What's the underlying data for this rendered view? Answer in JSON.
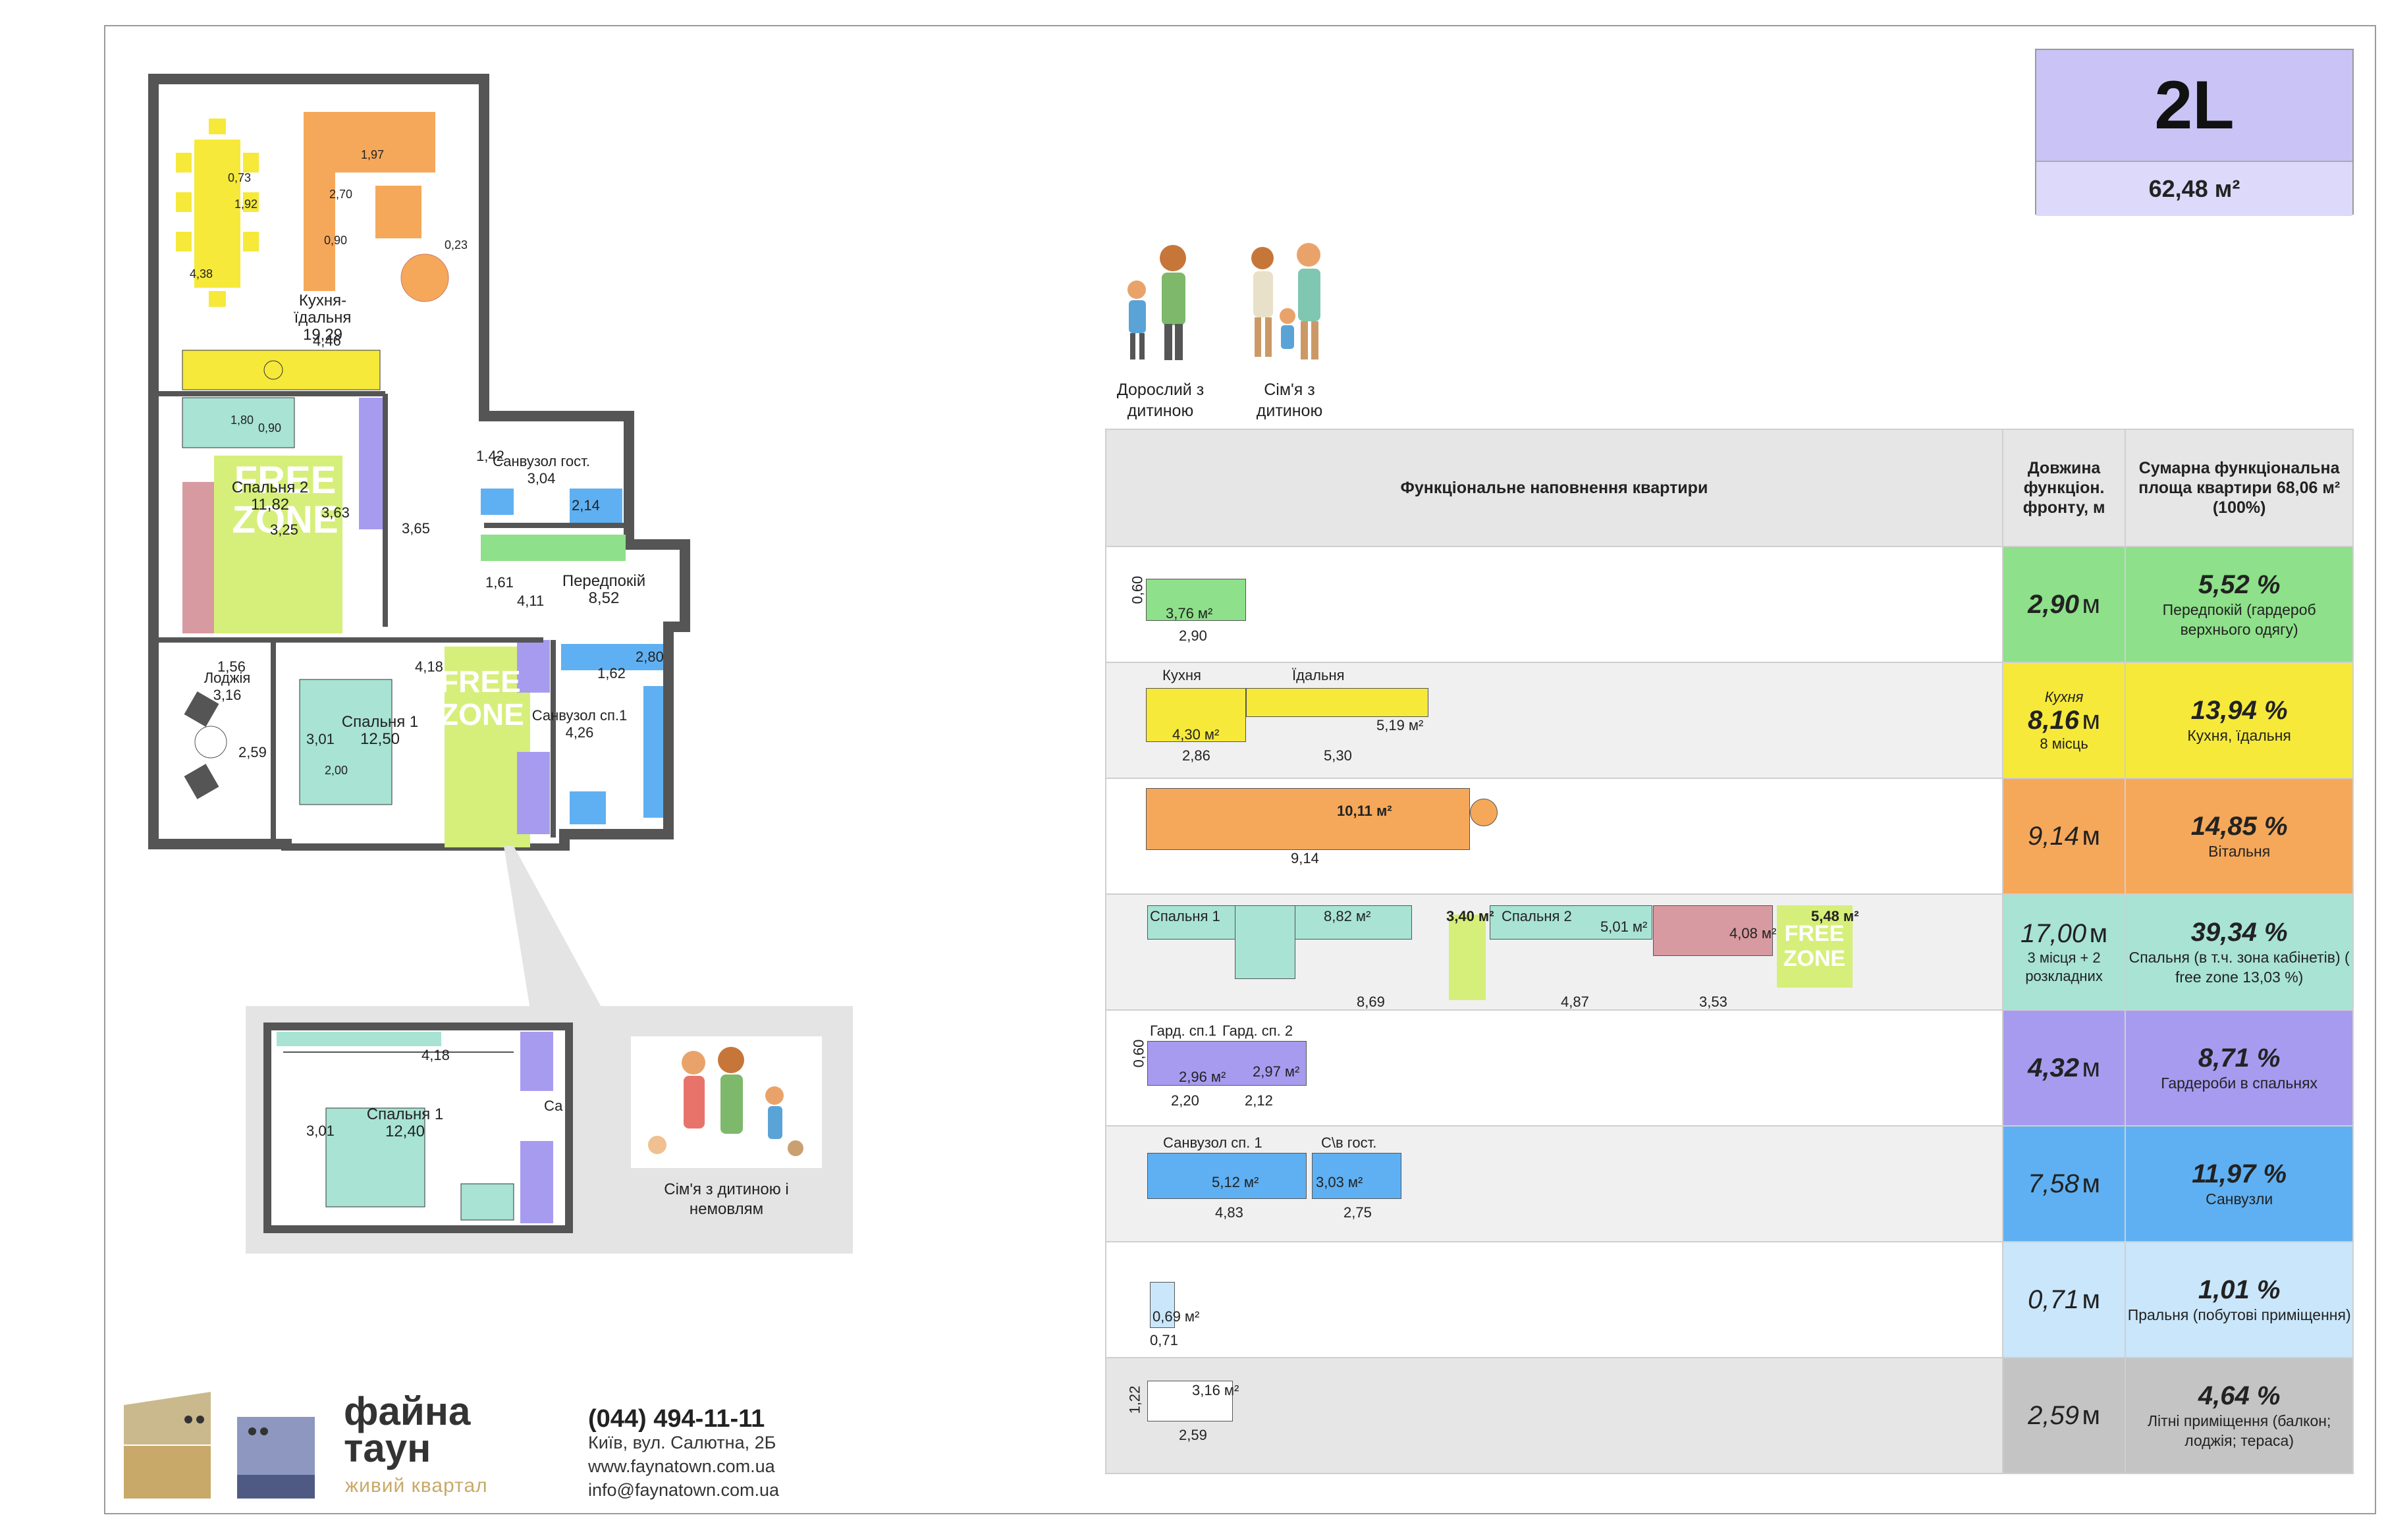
{
  "unit": {
    "code": "2L",
    "area": "62,48 м²"
  },
  "icons": [
    {
      "name": "adult-with-child-icon",
      "label": "Дорослий з дитиною"
    },
    {
      "name": "family-with-child-icon",
      "label": "Сім'я з дитиною"
    }
  ],
  "infant_icon": {
    "label": "Сім'я з дитиною і немовлям"
  },
  "plan": {
    "kitchen": {
      "label": "Кухня-їдальня",
      "area": "19,29"
    },
    "bedroom2": {
      "label": "Спальня 2",
      "area": "11,82"
    },
    "bathroom_guest": {
      "label": "Санвузол гост.",
      "area": "3,04"
    },
    "hallway": {
      "label": "Передпокій",
      "area": "8,52"
    },
    "loggia": {
      "label": "Лоджія",
      "area": "3,16"
    },
    "bedroom1": {
      "label": "Спальня 1",
      "area": "12,50"
    },
    "bathroom1": {
      "label": "Санвузол сп.1",
      "area": "4,26"
    },
    "free_zone": "FREE ZONE",
    "dims": [
      "4,38",
      "4,46",
      "1,97",
      "2,70",
      "0,90",
      "0,73",
      "1,92",
      "0,23",
      "1,80",
      "0,90",
      "3,25",
      "3,63",
      "3,65",
      "1,42",
      "2,14",
      "1,61",
      "4,11",
      "1,56",
      "2,59",
      "4,18",
      "3,01",
      "2,00",
      "1,62",
      "2,80"
    ]
  },
  "inset": {
    "label": "Спальня 1",
    "area": "12,40",
    "dims": [
      "4,18",
      "3,01"
    ],
    "cut_label": "Са"
  },
  "table": {
    "header": {
      "col1": "Функціональне наповнення квартири",
      "col2": "Довжина функціон. фронту, м",
      "col3": "Сумарна функціональна площа квартири 68,06 м² (100%)"
    },
    "rows": [
      {
        "len": "2,90",
        "unit": "м",
        "len_bold": true,
        "len_top": "",
        "len_sub": "",
        "pct": "5,52 %",
        "desc": "Передпокій (гардероб верхнього одягу)",
        "len_color": "#8ee08a",
        "pct_color": "#8ee08a",
        "labels": [
          "0,60",
          "3,76 м²",
          "2,90"
        ]
      },
      {
        "len": "8,16",
        "unit": "м",
        "len_bold": true,
        "len_top": "Кухня",
        "len_sub": "8 місць",
        "pct": "13,94 %",
        "desc": "Кухня, їдальня",
        "len_color": "#f6e93a",
        "pct_color": "#f6e93a",
        "labels": [
          "Кухня",
          "Їдальня",
          "4,30 м²",
          "5,19 м²",
          "2,86",
          "5,30"
        ]
      },
      {
        "len": "9,14",
        "unit": "м",
        "len_bold": false,
        "len_top": "",
        "len_sub": "",
        "pct": "14,85 %",
        "desc": "Вітальня",
        "len_color": "#f5a85a",
        "pct_color": "#f5a85a",
        "labels": [
          "10,11 м²",
          "9,14"
        ]
      },
      {
        "len": "17,00",
        "unit": "м",
        "len_bold": false,
        "len_top": "",
        "len_sub": "3 місця + 2 розкладних",
        "pct": "39,34 %",
        "desc": "Спальня (в т.ч. зона кабінетів) ( free zone 13,03 %)",
        "len_color": "#a8e3d4",
        "pct_color": "#a8e3d4",
        "labels": [
          "Спальня 1",
          "8,82 м²",
          "3,40 м²",
          "Спальня 2",
          "5,01 м²",
          "4,08 м²",
          "5,48 м²",
          "8,69",
          "4,87",
          "3,53",
          "FREE ZONE"
        ]
      },
      {
        "len": "4,32",
        "unit": "м",
        "len_bold": true,
        "len_top": "",
        "len_sub": "",
        "pct": "8,71 %",
        "desc": "Гардероби в спальнях",
        "len_color": "#a79bf0",
        "pct_color": "#a79bf0",
        "labels": [
          "0,60",
          "Гард. сп.1",
          "Гард. сп. 2",
          "2,96 м²",
          "2,97 м²",
          "2,20",
          "2,12"
        ]
      },
      {
        "len": "7,58",
        "unit": "м",
        "len_bold": false,
        "len_top": "",
        "len_sub": "",
        "pct": "11,97 %",
        "desc": "Санвузли",
        "len_color": "#5fb0f2",
        "pct_color": "#5fb0f2",
        "labels": [
          "Санвузол сп. 1",
          "С\\в гост.",
          "5,12 м²",
          "3,03 м²",
          "4,83",
          "2,75"
        ]
      },
      {
        "len": "0,71",
        "unit": "м",
        "len_bold": false,
        "len_top": "",
        "len_sub": "",
        "pct": "1,01 %",
        "desc": "Пральня (побутові приміщення)",
        "len_color": "#c9e6fa",
        "pct_color": "#c9e6fa",
        "labels": [
          "0,69 м²",
          "0,71"
        ]
      },
      {
        "len": "2,59",
        "unit": "м",
        "len_bold": false,
        "len_top": "",
        "len_sub": "",
        "pct": "4,64 %",
        "desc": "Літні приміщення (балкон; лоджія; тераса)",
        "len_color": "#c4c4c4",
        "pct_color": "#c4c4c4",
        "labels": [
          "1,22",
          "3,16 м²",
          "2,59"
        ]
      }
    ]
  },
  "brand": {
    "line1": "файна",
    "line2": "таун",
    "tagline": "живий квартал"
  },
  "contacts": {
    "phone": "(044) 494-11-11",
    "address": "Київ, вул. Салютна, 2Б",
    "web": "www.faynatown.com.ua",
    "email": "info@faynatown.com.ua"
  },
  "colors": {
    "kitchen": "#f6e93a",
    "living": "#f5a85a",
    "bedroom": "#a8e3d4",
    "wardrobe": "#a79bf0",
    "bath": "#5fb0f2",
    "hall": "#8ee08a",
    "free": "#d6ef7a",
    "laundry": "#c9e6fa"
  }
}
